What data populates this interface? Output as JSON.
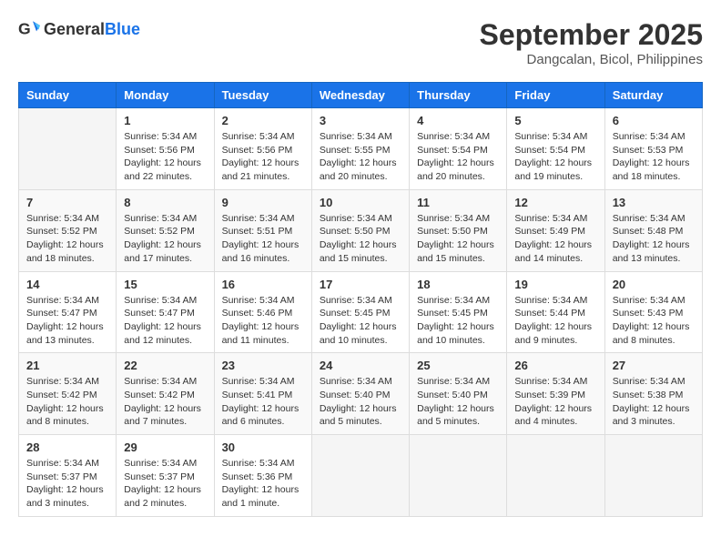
{
  "header": {
    "logo_general": "General",
    "logo_blue": "Blue",
    "month": "September 2025",
    "location": "Dangcalan, Bicol, Philippines"
  },
  "weekdays": [
    "Sunday",
    "Monday",
    "Tuesday",
    "Wednesday",
    "Thursday",
    "Friday",
    "Saturday"
  ],
  "weeks": [
    [
      {
        "day": "",
        "info": ""
      },
      {
        "day": "1",
        "info": "Sunrise: 5:34 AM\nSunset: 5:56 PM\nDaylight: 12 hours\nand 22 minutes."
      },
      {
        "day": "2",
        "info": "Sunrise: 5:34 AM\nSunset: 5:56 PM\nDaylight: 12 hours\nand 21 minutes."
      },
      {
        "day": "3",
        "info": "Sunrise: 5:34 AM\nSunset: 5:55 PM\nDaylight: 12 hours\nand 20 minutes."
      },
      {
        "day": "4",
        "info": "Sunrise: 5:34 AM\nSunset: 5:54 PM\nDaylight: 12 hours\nand 20 minutes."
      },
      {
        "day": "5",
        "info": "Sunrise: 5:34 AM\nSunset: 5:54 PM\nDaylight: 12 hours\nand 19 minutes."
      },
      {
        "day": "6",
        "info": "Sunrise: 5:34 AM\nSunset: 5:53 PM\nDaylight: 12 hours\nand 18 minutes."
      }
    ],
    [
      {
        "day": "7",
        "info": "Sunrise: 5:34 AM\nSunset: 5:52 PM\nDaylight: 12 hours\nand 18 minutes."
      },
      {
        "day": "8",
        "info": "Sunrise: 5:34 AM\nSunset: 5:52 PM\nDaylight: 12 hours\nand 17 minutes."
      },
      {
        "day": "9",
        "info": "Sunrise: 5:34 AM\nSunset: 5:51 PM\nDaylight: 12 hours\nand 16 minutes."
      },
      {
        "day": "10",
        "info": "Sunrise: 5:34 AM\nSunset: 5:50 PM\nDaylight: 12 hours\nand 15 minutes."
      },
      {
        "day": "11",
        "info": "Sunrise: 5:34 AM\nSunset: 5:50 PM\nDaylight: 12 hours\nand 15 minutes."
      },
      {
        "day": "12",
        "info": "Sunrise: 5:34 AM\nSunset: 5:49 PM\nDaylight: 12 hours\nand 14 minutes."
      },
      {
        "day": "13",
        "info": "Sunrise: 5:34 AM\nSunset: 5:48 PM\nDaylight: 12 hours\nand 13 minutes."
      }
    ],
    [
      {
        "day": "14",
        "info": "Sunrise: 5:34 AM\nSunset: 5:47 PM\nDaylight: 12 hours\nand 13 minutes."
      },
      {
        "day": "15",
        "info": "Sunrise: 5:34 AM\nSunset: 5:47 PM\nDaylight: 12 hours\nand 12 minutes."
      },
      {
        "day": "16",
        "info": "Sunrise: 5:34 AM\nSunset: 5:46 PM\nDaylight: 12 hours\nand 11 minutes."
      },
      {
        "day": "17",
        "info": "Sunrise: 5:34 AM\nSunset: 5:45 PM\nDaylight: 12 hours\nand 10 minutes."
      },
      {
        "day": "18",
        "info": "Sunrise: 5:34 AM\nSunset: 5:45 PM\nDaylight: 12 hours\nand 10 minutes."
      },
      {
        "day": "19",
        "info": "Sunrise: 5:34 AM\nSunset: 5:44 PM\nDaylight: 12 hours\nand 9 minutes."
      },
      {
        "day": "20",
        "info": "Sunrise: 5:34 AM\nSunset: 5:43 PM\nDaylight: 12 hours\nand 8 minutes."
      }
    ],
    [
      {
        "day": "21",
        "info": "Sunrise: 5:34 AM\nSunset: 5:42 PM\nDaylight: 12 hours\nand 8 minutes."
      },
      {
        "day": "22",
        "info": "Sunrise: 5:34 AM\nSunset: 5:42 PM\nDaylight: 12 hours\nand 7 minutes."
      },
      {
        "day": "23",
        "info": "Sunrise: 5:34 AM\nSunset: 5:41 PM\nDaylight: 12 hours\nand 6 minutes."
      },
      {
        "day": "24",
        "info": "Sunrise: 5:34 AM\nSunset: 5:40 PM\nDaylight: 12 hours\nand 5 minutes."
      },
      {
        "day": "25",
        "info": "Sunrise: 5:34 AM\nSunset: 5:40 PM\nDaylight: 12 hours\nand 5 minutes."
      },
      {
        "day": "26",
        "info": "Sunrise: 5:34 AM\nSunset: 5:39 PM\nDaylight: 12 hours\nand 4 minutes."
      },
      {
        "day": "27",
        "info": "Sunrise: 5:34 AM\nSunset: 5:38 PM\nDaylight: 12 hours\nand 3 minutes."
      }
    ],
    [
      {
        "day": "28",
        "info": "Sunrise: 5:34 AM\nSunset: 5:37 PM\nDaylight: 12 hours\nand 3 minutes."
      },
      {
        "day": "29",
        "info": "Sunrise: 5:34 AM\nSunset: 5:37 PM\nDaylight: 12 hours\nand 2 minutes."
      },
      {
        "day": "30",
        "info": "Sunrise: 5:34 AM\nSunset: 5:36 PM\nDaylight: 12 hours\nand 1 minute."
      },
      {
        "day": "",
        "info": ""
      },
      {
        "day": "",
        "info": ""
      },
      {
        "day": "",
        "info": ""
      },
      {
        "day": "",
        "info": ""
      }
    ]
  ]
}
